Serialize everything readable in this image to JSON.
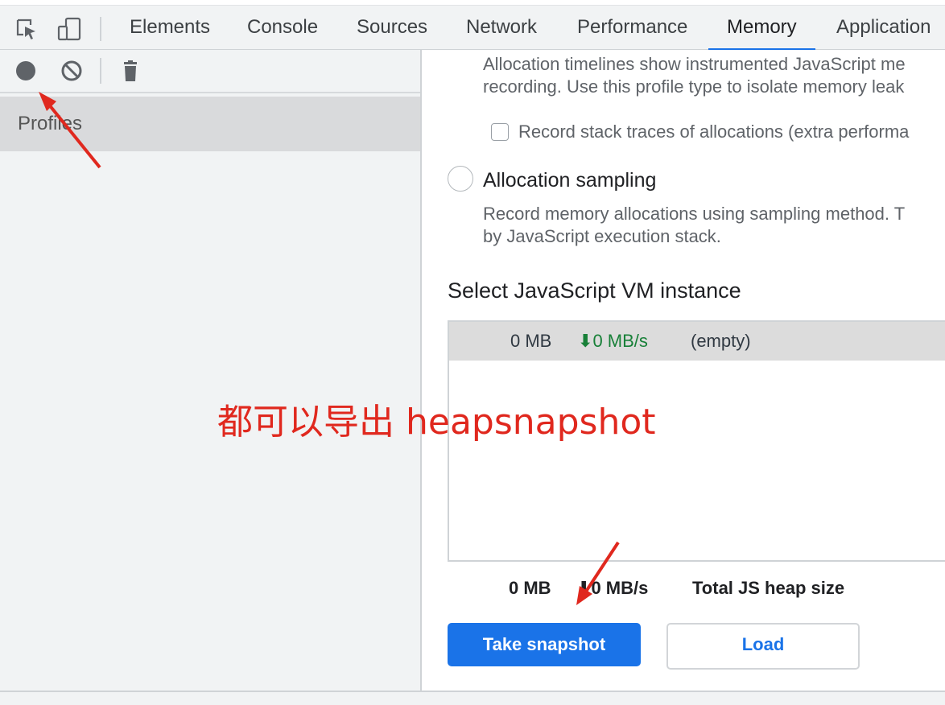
{
  "tabs": [
    {
      "label": "Elements"
    },
    {
      "label": "Console"
    },
    {
      "label": "Sources"
    },
    {
      "label": "Network"
    },
    {
      "label": "Performance"
    },
    {
      "label": "Memory"
    },
    {
      "label": "Application"
    }
  ],
  "active_tab": "Memory",
  "toolbar_icons": [
    "inspect-element-icon",
    "device-toolbar-icon"
  ],
  "left_toolbar_icons": [
    "record-icon",
    "clear-icon",
    "trash-icon"
  ],
  "sidebar": {
    "profiles_label": "Profiles"
  },
  "profile_types": {
    "allocation_timeline_desc_line1": "Allocation timelines show instrumented JavaScript me",
    "allocation_timeline_desc_line2": "recording. Use this profile type to isolate memory leak",
    "record_stack_traces_label": "Record stack traces of allocations (extra performa",
    "allocation_sampling_title": "Allocation sampling",
    "allocation_sampling_desc_line1": "Record memory allocations using sampling method. T",
    "allocation_sampling_desc_line2": "by JavaScript execution stack."
  },
  "vm_section": {
    "title": "Select JavaScript VM instance",
    "row": {
      "size": "0 MB",
      "rate": "0 MB/s",
      "name": "(empty)"
    }
  },
  "summary": {
    "size": "0 MB",
    "rate": "0 MB/s",
    "label": "Total JS heap size"
  },
  "buttons": {
    "take_snapshot": "Take snapshot",
    "load": "Load"
  },
  "annotation": {
    "text": "都可以导出 heapsnapshot"
  },
  "colors": {
    "accent": "#1a73e8",
    "green_rate": "#188038",
    "annotation_red": "#e0281e"
  }
}
